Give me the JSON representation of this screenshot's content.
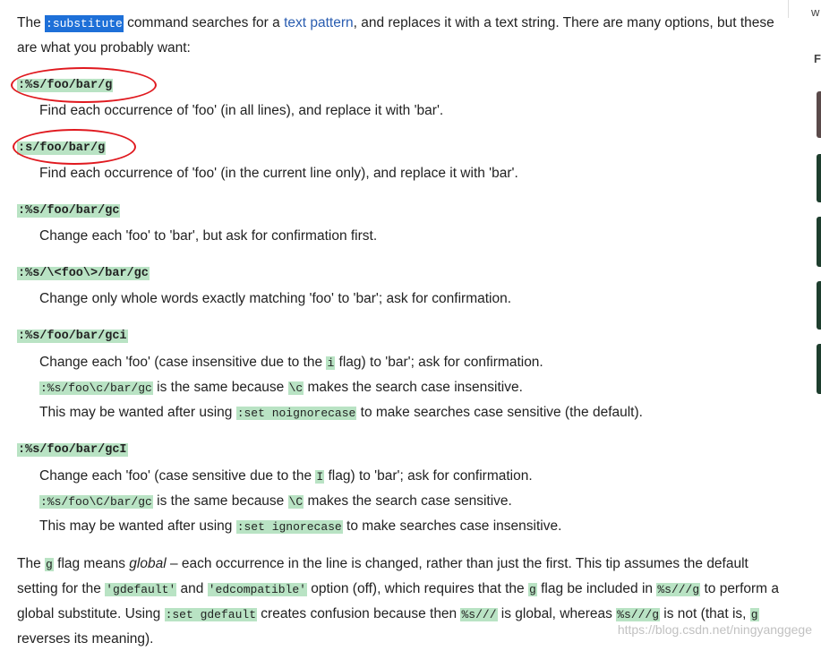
{
  "intro": {
    "the": "The",
    "cmd": ":substitute",
    "t1": " command searches for a ",
    "link": "text pattern",
    "t2": ", and replaces it with a text string. There are many options, but these are what you probably want:"
  },
  "entries": [
    {
      "term": ":%s/foo/bar/g",
      "lines": [
        "Find each occurrence of 'foo' (in all lines), and replace it with 'bar'."
      ]
    },
    {
      "term": ":s/foo/bar/g",
      "lines": [
        "Find each occurrence of 'foo' (in the current line only), and replace it with 'bar'."
      ]
    },
    {
      "term": ":%s/foo/bar/gc",
      "lines": [
        "Change each 'foo' to 'bar', but ask for confirmation first."
      ]
    },
    {
      "term": ":%s/\\<foo\\>/bar/gc",
      "lines": [
        "Change only whole words exactly matching 'foo' to 'bar'; ask for confirmation."
      ]
    },
    {
      "term": ":%s/foo/bar/gci",
      "l1a": "Change each 'foo' (case insensitive due to the ",
      "l1code": "i",
      "l1b": " flag) to 'bar'; ask for confirmation.",
      "l2code": ":%s/foo\\c/bar/gc",
      "l2a": " is the same because ",
      "l2code2": "\\c",
      "l2b": " makes the search case insensitive.",
      "l3a": "This may be wanted after using ",
      "l3code": ":set noignorecase",
      "l3b": " to make searches case sensitive (the default)."
    },
    {
      "term": ":%s/foo/bar/gcI",
      "l1a": "Change each 'foo' (case sensitive due to the ",
      "l1code": "I",
      "l1b": " flag) to 'bar'; ask for confirmation.",
      "l2code": ":%s/foo\\C/bar/gc",
      "l2a": " is the same because ",
      "l2code2": "\\C",
      "l2b": " makes the search case sensitive.",
      "l3a": "This may be wanted after using ",
      "l3code": ":set ignorecase",
      "l3b": " to make searches case insensitive."
    }
  ],
  "outro": {
    "a": "The ",
    "g1": "g",
    "b": " flag means ",
    "global": "global",
    "c": " – each occurrence in the line is changed, rather than just the first. This tip assumes the default setting for the ",
    "gdefault": "'gdefault'",
    "d": " and ",
    "edcompatible": "'edcompatible'",
    "e": " option (off), which requires that the ",
    "g2": "g",
    "f": " flag be included in ",
    "sg": "%s///g",
    "h": " to perform a global substitute. Using ",
    "setgd": ":set gdefault",
    "i": " creates confusion because then ",
    "s3": "%s///",
    "j": " is global, whereas ",
    "sg2": "%s///g",
    "k": " is not (that is, ",
    "g3": "g",
    "l": " reverses its meaning)."
  },
  "sidebar": {
    "w": "w",
    "f": "F"
  },
  "watermark": "https://blog.csdn.net/ningyanggege"
}
